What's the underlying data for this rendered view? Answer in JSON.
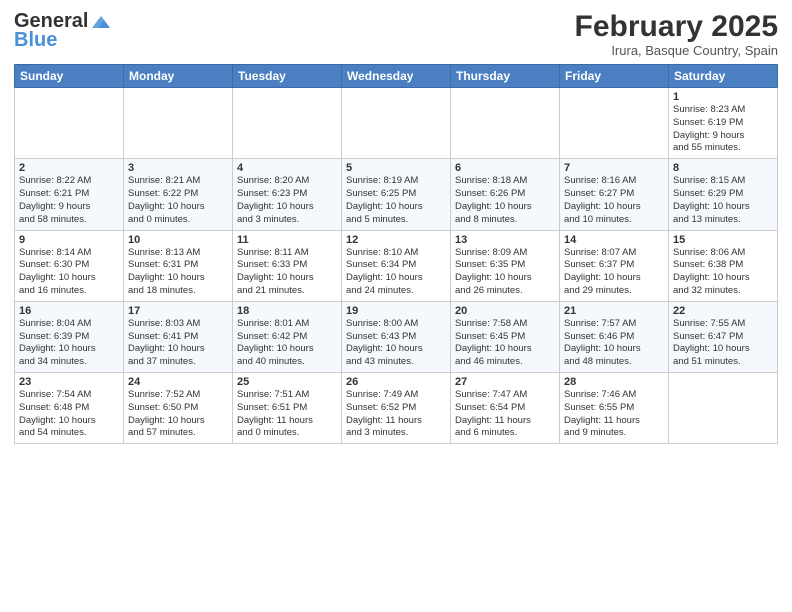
{
  "header": {
    "logo_line1": "General",
    "logo_line2": "Blue",
    "month_title": "February 2025",
    "location": "Irura, Basque Country, Spain"
  },
  "days_of_week": [
    "Sunday",
    "Monday",
    "Tuesday",
    "Wednesday",
    "Thursday",
    "Friday",
    "Saturday"
  ],
  "weeks": [
    [
      {
        "day": "",
        "info": ""
      },
      {
        "day": "",
        "info": ""
      },
      {
        "day": "",
        "info": ""
      },
      {
        "day": "",
        "info": ""
      },
      {
        "day": "",
        "info": ""
      },
      {
        "day": "",
        "info": ""
      },
      {
        "day": "1",
        "info": "Sunrise: 8:23 AM\nSunset: 6:19 PM\nDaylight: 9 hours\nand 55 minutes."
      }
    ],
    [
      {
        "day": "2",
        "info": "Sunrise: 8:22 AM\nSunset: 6:21 PM\nDaylight: 9 hours\nand 58 minutes."
      },
      {
        "day": "3",
        "info": "Sunrise: 8:21 AM\nSunset: 6:22 PM\nDaylight: 10 hours\nand 0 minutes."
      },
      {
        "day": "4",
        "info": "Sunrise: 8:20 AM\nSunset: 6:23 PM\nDaylight: 10 hours\nand 3 minutes."
      },
      {
        "day": "5",
        "info": "Sunrise: 8:19 AM\nSunset: 6:25 PM\nDaylight: 10 hours\nand 5 minutes."
      },
      {
        "day": "6",
        "info": "Sunrise: 8:18 AM\nSunset: 6:26 PM\nDaylight: 10 hours\nand 8 minutes."
      },
      {
        "day": "7",
        "info": "Sunrise: 8:16 AM\nSunset: 6:27 PM\nDaylight: 10 hours\nand 10 minutes."
      },
      {
        "day": "8",
        "info": "Sunrise: 8:15 AM\nSunset: 6:29 PM\nDaylight: 10 hours\nand 13 minutes."
      }
    ],
    [
      {
        "day": "9",
        "info": "Sunrise: 8:14 AM\nSunset: 6:30 PM\nDaylight: 10 hours\nand 16 minutes."
      },
      {
        "day": "10",
        "info": "Sunrise: 8:13 AM\nSunset: 6:31 PM\nDaylight: 10 hours\nand 18 minutes."
      },
      {
        "day": "11",
        "info": "Sunrise: 8:11 AM\nSunset: 6:33 PM\nDaylight: 10 hours\nand 21 minutes."
      },
      {
        "day": "12",
        "info": "Sunrise: 8:10 AM\nSunset: 6:34 PM\nDaylight: 10 hours\nand 24 minutes."
      },
      {
        "day": "13",
        "info": "Sunrise: 8:09 AM\nSunset: 6:35 PM\nDaylight: 10 hours\nand 26 minutes."
      },
      {
        "day": "14",
        "info": "Sunrise: 8:07 AM\nSunset: 6:37 PM\nDaylight: 10 hours\nand 29 minutes."
      },
      {
        "day": "15",
        "info": "Sunrise: 8:06 AM\nSunset: 6:38 PM\nDaylight: 10 hours\nand 32 minutes."
      }
    ],
    [
      {
        "day": "16",
        "info": "Sunrise: 8:04 AM\nSunset: 6:39 PM\nDaylight: 10 hours\nand 34 minutes."
      },
      {
        "day": "17",
        "info": "Sunrise: 8:03 AM\nSunset: 6:41 PM\nDaylight: 10 hours\nand 37 minutes."
      },
      {
        "day": "18",
        "info": "Sunrise: 8:01 AM\nSunset: 6:42 PM\nDaylight: 10 hours\nand 40 minutes."
      },
      {
        "day": "19",
        "info": "Sunrise: 8:00 AM\nSunset: 6:43 PM\nDaylight: 10 hours\nand 43 minutes."
      },
      {
        "day": "20",
        "info": "Sunrise: 7:58 AM\nSunset: 6:45 PM\nDaylight: 10 hours\nand 46 minutes."
      },
      {
        "day": "21",
        "info": "Sunrise: 7:57 AM\nSunset: 6:46 PM\nDaylight: 10 hours\nand 48 minutes."
      },
      {
        "day": "22",
        "info": "Sunrise: 7:55 AM\nSunset: 6:47 PM\nDaylight: 10 hours\nand 51 minutes."
      }
    ],
    [
      {
        "day": "23",
        "info": "Sunrise: 7:54 AM\nSunset: 6:48 PM\nDaylight: 10 hours\nand 54 minutes."
      },
      {
        "day": "24",
        "info": "Sunrise: 7:52 AM\nSunset: 6:50 PM\nDaylight: 10 hours\nand 57 minutes."
      },
      {
        "day": "25",
        "info": "Sunrise: 7:51 AM\nSunset: 6:51 PM\nDaylight: 11 hours\nand 0 minutes."
      },
      {
        "day": "26",
        "info": "Sunrise: 7:49 AM\nSunset: 6:52 PM\nDaylight: 11 hours\nand 3 minutes."
      },
      {
        "day": "27",
        "info": "Sunrise: 7:47 AM\nSunset: 6:54 PM\nDaylight: 11 hours\nand 6 minutes."
      },
      {
        "day": "28",
        "info": "Sunrise: 7:46 AM\nSunset: 6:55 PM\nDaylight: 11 hours\nand 9 minutes."
      },
      {
        "day": "",
        "info": ""
      }
    ]
  ]
}
